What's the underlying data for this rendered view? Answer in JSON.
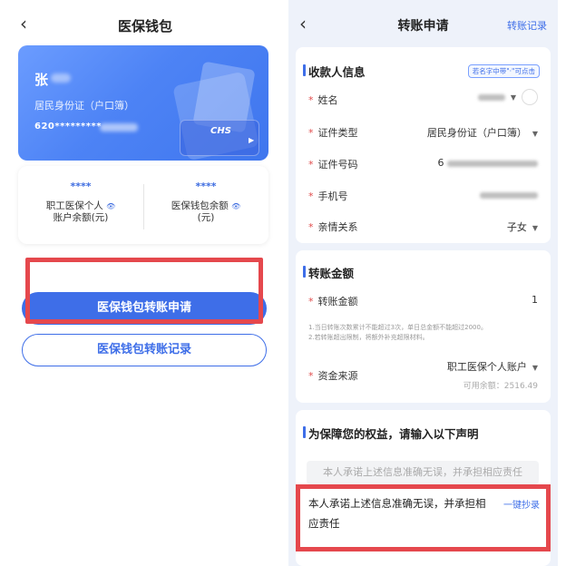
{
  "left": {
    "nav": {
      "back_icon": "‹",
      "title": "医保钱包"
    },
    "card": {
      "name": "张",
      "id_type": "居民身份证（户口簿）",
      "id_number": "620*********",
      "logo_text": "CHS"
    },
    "balances": [
      {
        "value": "****",
        "label_line1": "职工医保个人",
        "label_line2": "账户余额(元)"
      },
      {
        "value": "****",
        "label_line1": "医保钱包余额",
        "label_line2": "(元)"
      }
    ],
    "apply_button": "医保钱包转账申请",
    "record_button": "医保钱包转账记录"
  },
  "right": {
    "nav": {
      "back_icon": "‹",
      "title": "转账申请",
      "records_link": "转账记录"
    },
    "payee": {
      "section_title": "收款人信息",
      "tag": "若名字中带\"·\"可点击",
      "rows": [
        {
          "label": "姓名",
          "value": ""
        },
        {
          "label": "证件类型",
          "value": "居民身份证（户口簿）"
        },
        {
          "label": "证件号码",
          "value": "6"
        },
        {
          "label": "手机号",
          "value": ""
        },
        {
          "label": "亲情关系",
          "value": "子女"
        }
      ]
    },
    "amount": {
      "section_title": "转账金额",
      "label": "转账金额",
      "value": "1",
      "hint_line1": "1.当日转账次数累计不能超过3次，单日总金额不能超过2000。",
      "hint_line2": "2.若转账超出限制，将额外补充超限材料。",
      "source_label": "资金来源",
      "source_value": "职工医保个人账户",
      "available": "可用余额：2516.49"
    },
    "statement": {
      "section_title": "为保障您的权益，请输入以下声明",
      "template": "本人承诺上述信息准确无误，并承担相应责任",
      "input_line1": "本人承诺上述信息准确无误，并承担相",
      "input_line2": "应责任",
      "copy_link": "一键抄录"
    }
  },
  "colors": {
    "accent": "#3e6ee8",
    "highlight": "#e5484d",
    "required": "#e04b4b"
  }
}
